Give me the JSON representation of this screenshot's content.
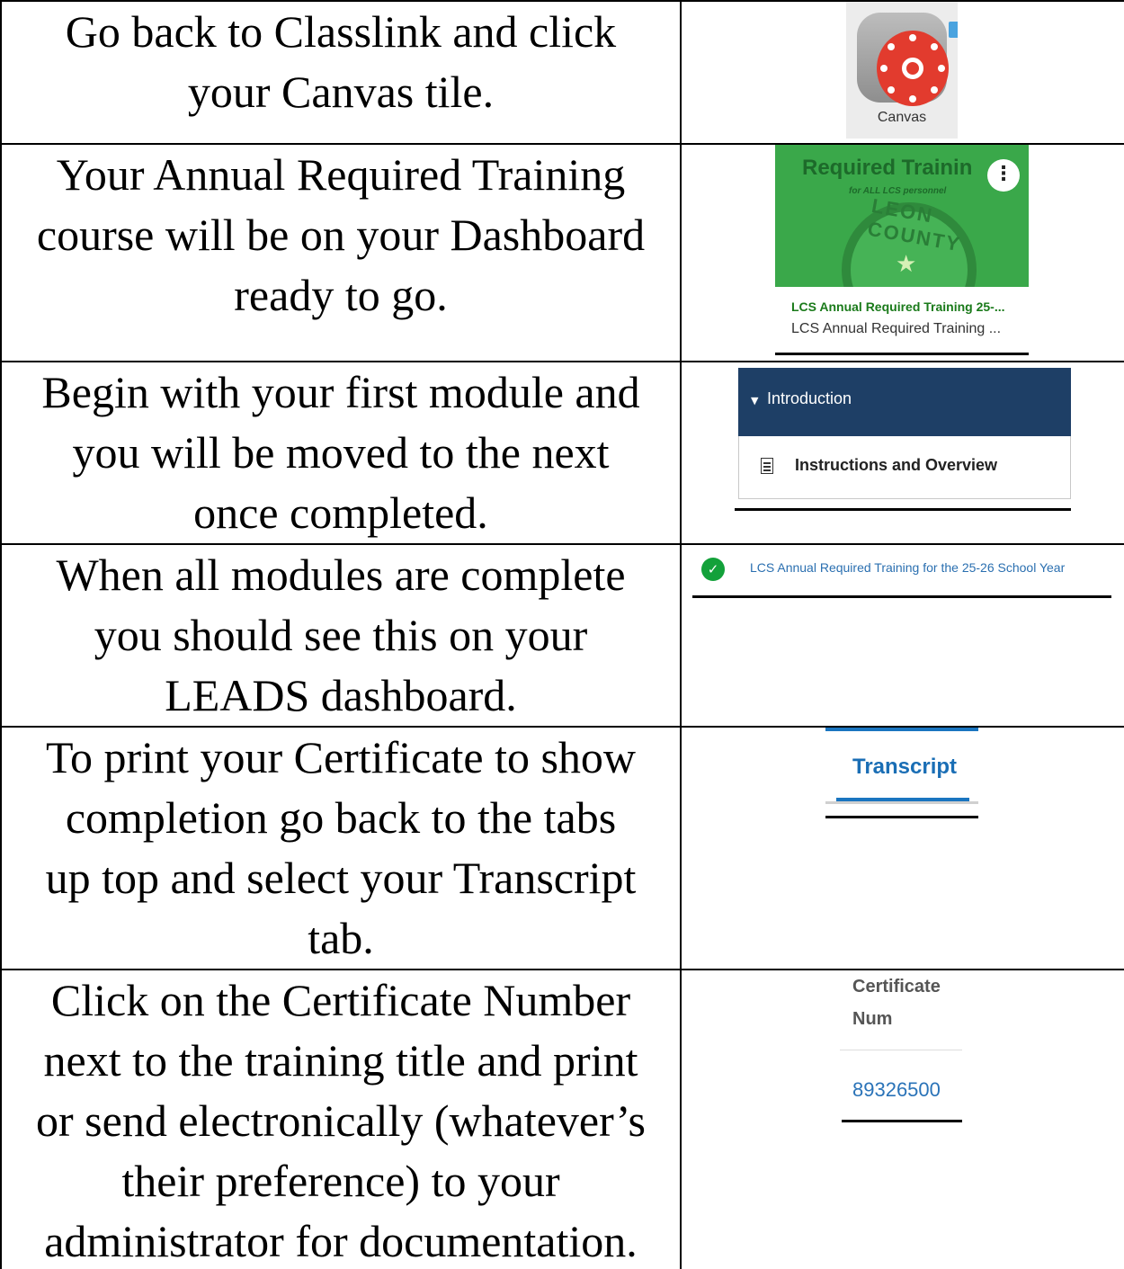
{
  "steps": [
    {
      "instruction": [
        "Go back to Classlink and click",
        "your Canvas tile."
      ]
    },
    {
      "instruction": [
        "Your Annual Required Training",
        "course will be on your Dashboard",
        "ready to go."
      ]
    },
    {
      "instruction": [
        "Begin with your first module and",
        "you will be moved to the next",
        "once completed."
      ]
    },
    {
      "instruction": [
        "When all modules are complete",
        "you should see this on your",
        "LEADS dashboard."
      ]
    },
    {
      "instruction": [
        "To print your Certificate to show",
        "completion go back to the tabs",
        "up top and select your Transcript",
        "tab."
      ]
    },
    {
      "instruction": [
        "Click on the Certificate Number",
        "next to the training title and print",
        "or send electronically (whatever’s",
        "their preference) to your",
        "administrator for documentation."
      ]
    }
  ],
  "canvas_tile": {
    "label": "Canvas",
    "icon": "canvas-logo-icon"
  },
  "course_card": {
    "banner_title": "Required Trainin",
    "banner_subtitle": "for ALL LCS personnel",
    "seal_text": "LEON COUNTY",
    "title": "LCS Annual Required Training 25-...",
    "code": "LCS Annual Required Training ...",
    "menu_icon": "kebab-menu-icon"
  },
  "module": {
    "header": "Introduction",
    "item": "Instructions and Overview",
    "item_icon": "document-icon"
  },
  "completed": {
    "text": "LCS Annual Required Training for the 25-26 School Year",
    "icon": "check-circle-icon"
  },
  "transcript_tab": {
    "label": "Transcript"
  },
  "certificate": {
    "header_line1": "Certificate",
    "header_line2": "Num",
    "number": "89326500"
  },
  "colors": {
    "canvas_red": "#e23b2e",
    "banner_green": "#3aa84a",
    "module_navy": "#1e3f66",
    "check_green": "#13a13a",
    "link_blue": "#2a6fb0"
  }
}
